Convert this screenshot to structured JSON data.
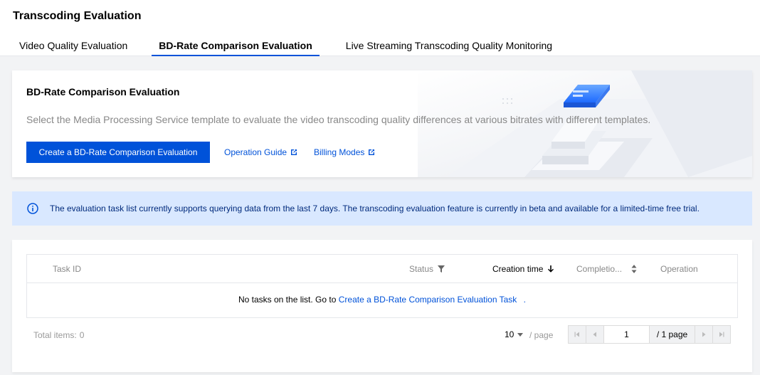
{
  "header": {
    "title": "Transcoding Evaluation",
    "tabs": [
      {
        "label": "Video Quality Evaluation"
      },
      {
        "label": "BD-Rate Comparison Evaluation"
      },
      {
        "label": "Live Streaming Transcoding Quality Monitoring"
      }
    ],
    "active_tab": 1
  },
  "banner": {
    "title": "BD-Rate Comparison Evaluation",
    "description": "Select the Media Processing Service template to evaluate the video transcoding quality differences at various bitrates with different templates.",
    "create_label": "Create a BD-Rate Comparison Evaluation",
    "guide_label": "Operation Guide",
    "billing_label": "Billing Modes"
  },
  "info": {
    "text": "The evaluation task list currently supports querying data from the last 7 days. The transcoding evaluation feature is currently in beta and available for a limited-time free trial."
  },
  "table": {
    "columns": {
      "task_id": "Task ID",
      "status": "Status",
      "creation_time": "Creation time",
      "completion": "Completio...",
      "operation": "Operation"
    },
    "empty_text": "No tasks on the list. Go to",
    "empty_link": "Create a BD-Rate Comparison Evaluation Task",
    "empty_suffix": "."
  },
  "pagination": {
    "total_label": "Total items:",
    "total_value": "0",
    "page_size": "10",
    "per_page_label": "/ page",
    "current_page": "1",
    "total_pages": "/ 1 page"
  },
  "colors": {
    "accent": "#0052d9",
    "info_bg": "#d9e8ff"
  }
}
